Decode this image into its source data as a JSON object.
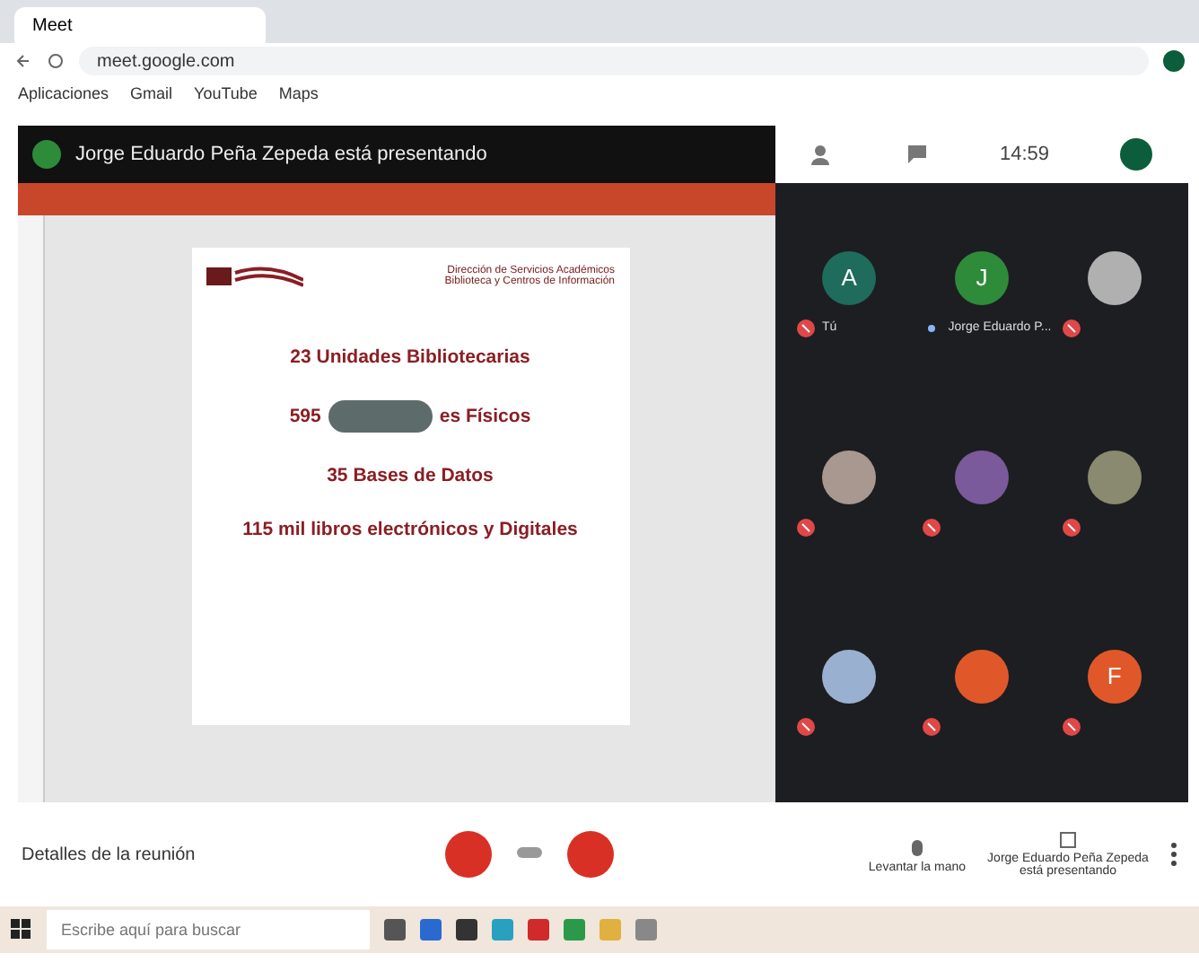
{
  "browser": {
    "tab_title": "Meet",
    "url": "meet.google.com",
    "bookmarks": [
      "Aplicaciones",
      "Gmail",
      "YouTube",
      "Maps"
    ]
  },
  "meet_bar": {
    "presenter": "Jorge Eduardo Peña Zepeda está presentando",
    "time": "14:59"
  },
  "slide": {
    "header": [
      "Dirección de Servicios Académicos",
      "Biblioteca y Centros de Información"
    ],
    "lines": [
      {
        "kind": "text",
        "text": "23 Unidades Bibliotecarias"
      },
      {
        "kind": "covered",
        "before": "595",
        "after": "es Físicos"
      },
      {
        "kind": "text",
        "text": "35 Bases de Datos"
      },
      {
        "kind": "text",
        "text": "115 mil libros electrónicos y Digitales"
      }
    ]
  },
  "participants": [
    {
      "kind": "letter",
      "letter": "A",
      "color": "#1f6b5c",
      "name": "Tú",
      "muted": true
    },
    {
      "kind": "letter",
      "letter": "J",
      "color": "#2e8b3a",
      "name": "Jorge Eduardo P...",
      "muted": false
    },
    {
      "kind": "photo",
      "color": "#b0b0b0",
      "muted": true
    },
    {
      "kind": "photo",
      "color": "#a89890",
      "muted": true
    },
    {
      "kind": "photo",
      "color": "#7a5a9a",
      "muted": true
    },
    {
      "kind": "photo",
      "color": "#8a8a70",
      "muted": true
    },
    {
      "kind": "photo",
      "color": "#9ab0d0",
      "muted": true
    },
    {
      "kind": "photo",
      "color": "#e0582a",
      "muted": true
    },
    {
      "kind": "letter",
      "letter": "F",
      "color": "#e0582a",
      "muted": true
    }
  ],
  "controls": {
    "details": "Detalles de la reunión",
    "raise_hand": "Levantar la mano",
    "presenting": "Jorge Eduardo Peña Zepeda está presentando"
  },
  "taskbar": {
    "search_placeholder": "Escribe aquí para buscar"
  }
}
